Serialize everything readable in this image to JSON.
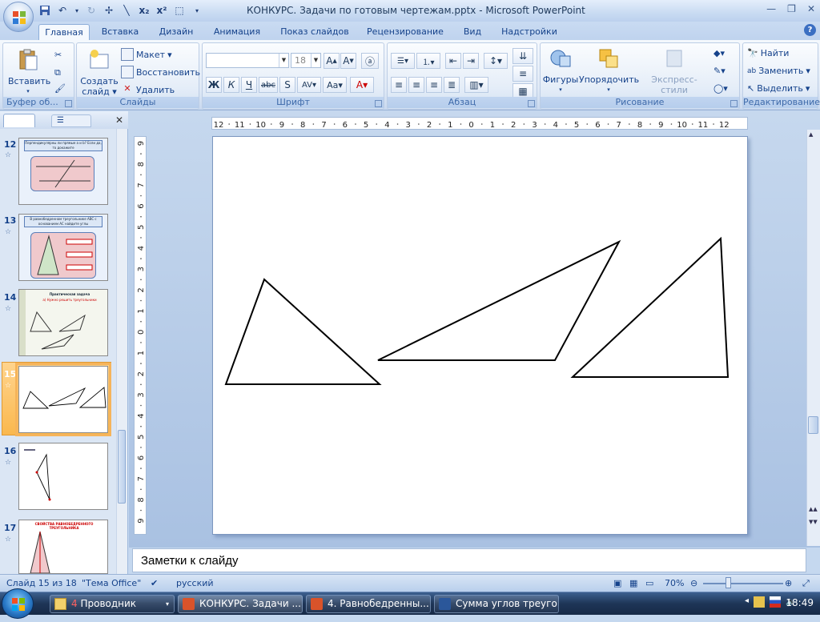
{
  "window": {
    "title": "КОНКУРС. Задачи по готовым чертежам.pptx - Microsoft PowerPoint"
  },
  "ribbon_tabs": [
    "Главная",
    "Вставка",
    "Дизайн",
    "Анимация",
    "Показ слайдов",
    "Рецензирование",
    "Вид",
    "Надстройки"
  ],
  "ribbon": {
    "clipboard": {
      "paste": "Вставить",
      "label": "Буфер об..."
    },
    "slides": {
      "new_slide_1": "Создать",
      "new_slide_2": "слайд",
      "layout": "Макет",
      "reset": "Восстановить",
      "delete": "Удалить",
      "label": "Слайды"
    },
    "font": {
      "size": "18",
      "label": "Шрифт"
    },
    "paragraph": {
      "label": "Абзац"
    },
    "drawing": {
      "shapes": "Фигуры",
      "arrange": "Упорядочить",
      "quick_styles": "Экспресс-стили",
      "label": "Рисование"
    },
    "editing": {
      "find": "Найти",
      "replace": "Заменить",
      "select": "Выделить",
      "label": "Редактирование"
    }
  },
  "thumbnails": [
    {
      "num": "12",
      "title": "Перпендикулярны ли прямые а и b? Если да, то докажите"
    },
    {
      "num": "13",
      "title": "В равнобедренном треугольнике ABC с основанием AC найдите углы"
    },
    {
      "num": "14",
      "title": "Практическая задача",
      "subtitle": "а) Нужно решить треугольники"
    },
    {
      "num": "15"
    },
    {
      "num": "16"
    },
    {
      "num": "17",
      "title": "СВОЙСТВА РАВНОБЕДРЕННОГО ТРЕУГОЛЬНИКА"
    }
  ],
  "hruler_ticks": [
    "12",
    "11",
    "10",
    "9",
    "8",
    "7",
    "6",
    "5",
    "4",
    "3",
    "2",
    "1",
    "0",
    "1",
    "2",
    "3",
    "4",
    "5",
    "6",
    "7",
    "8",
    "9",
    "10",
    "11",
    "12"
  ],
  "vruler_ticks": [
    "9",
    "8",
    "7",
    "6",
    "5",
    "4",
    "3",
    "2",
    "1",
    "0",
    "1",
    "2",
    "3",
    "4",
    "5",
    "6",
    "7",
    "8",
    "9"
  ],
  "notes_placeholder": "Заметки к слайду",
  "status": {
    "slide": "Слайд 15 из 18",
    "theme": "\"Тема Office\"",
    "language": "русский",
    "zoom": "70%"
  },
  "taskbar": {
    "items": [
      {
        "count": "4",
        "label": "Проводник"
      },
      {
        "label": "КОНКУРС. Задачи ..."
      },
      {
        "label": "4. Равнобедренны..."
      },
      {
        "label": "Сумма углов треуго..."
      }
    ],
    "clock": "18:49"
  },
  "colors": {
    "accent": "#15428b",
    "selection": "#fab84e",
    "title_red": "#c00000"
  }
}
